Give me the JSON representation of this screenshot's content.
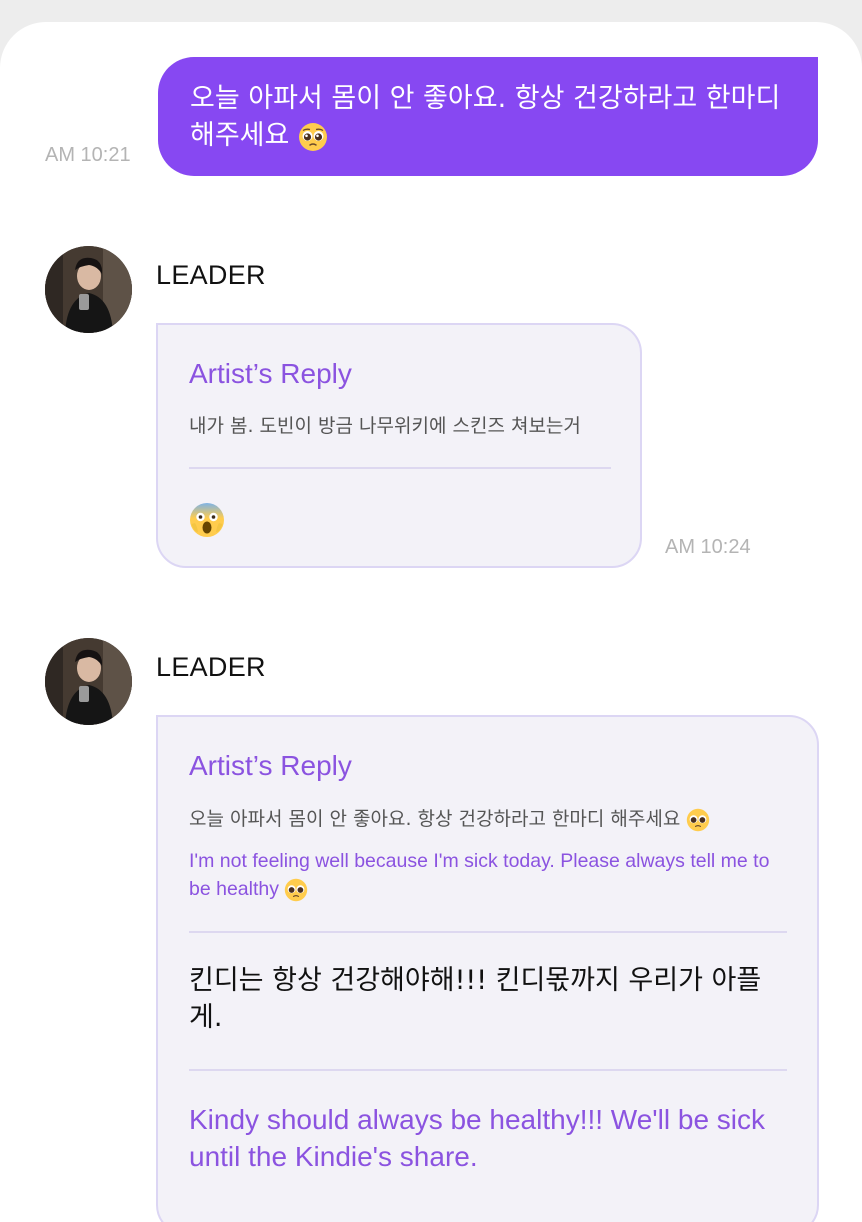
{
  "sent_message": {
    "text": "오늘 아파서 몸이 안 좋아요. 항상 건강하라고 한마디 해주세요",
    "emoji": "pleading-face",
    "time": "AM 10:21"
  },
  "messages": [
    {
      "sender": "LEADER",
      "reply_title": "Artist’s Reply",
      "original_text": "내가 봄. 도빈이 방금 나무위키에 스킨즈 쳐보는거",
      "reply_emoji": "screaming-face",
      "time": "AM 10:24"
    },
    {
      "sender": "LEADER",
      "reply_title": "Artist’s Reply",
      "original_text": "오늘 아파서 몸이 안 좋아요. 항상 건강하라고 한마디 해주세요",
      "original_translation": "I'm not feeling well because I'm sick today. Please always tell me to be healthy",
      "reply_text": "킨디는 항상 건강해야해!!! 킨디몫까지 우리가 아플게.",
      "reply_translation": "Kindy should always be healthy!!! We'll be sick until the Kindie's share."
    }
  ],
  "colors": {
    "accent": "#8748f2",
    "reply_text": "#8b53e0",
    "card_bg": "#f3f2f8",
    "card_border": "#dcd6f4",
    "timestamp": "#b4b4b4"
  }
}
